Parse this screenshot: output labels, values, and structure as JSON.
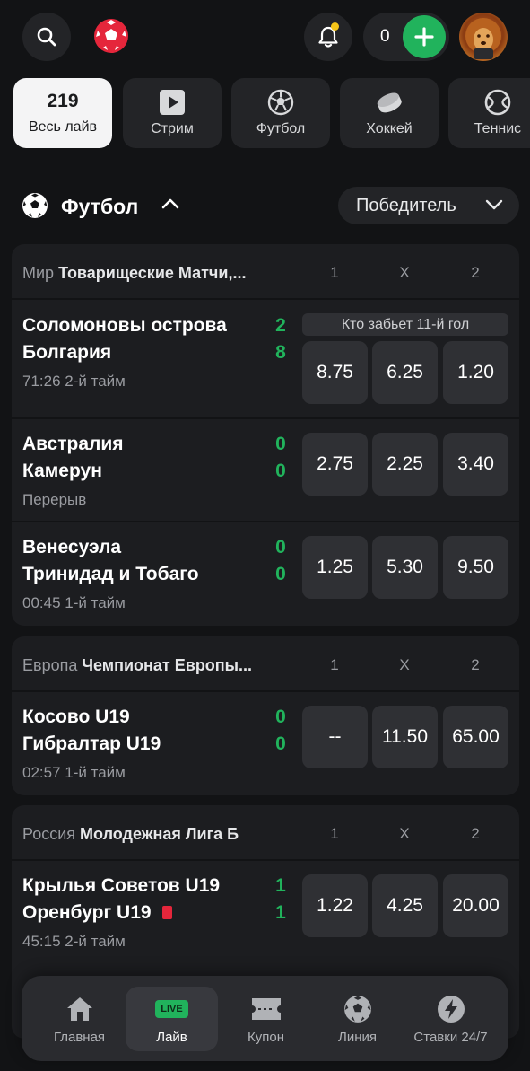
{
  "header": {
    "balance": "0",
    "icons": [
      "search-icon",
      "bell-icon",
      "plus-icon"
    ]
  },
  "categories": [
    {
      "count": "219",
      "label": "Весь лайв"
    },
    {
      "label": "Стрим",
      "icon": "play-icon"
    },
    {
      "label": "Футбол",
      "icon": "soccer-ball-icon"
    },
    {
      "label": "Хоккей",
      "icon": "hockey-puck-icon"
    },
    {
      "label": "Теннис",
      "icon": "tennis-ball-icon"
    }
  ],
  "sport": {
    "title": "Футбол",
    "market": "Победитель"
  },
  "columns": {
    "c1": "1",
    "cx": "X",
    "c2": "2"
  },
  "leagues": [
    {
      "region": "Мир",
      "name": "Товарищеские Матчи,...",
      "matches": [
        {
          "team1": "Соломоновы острова",
          "team2": "Болгария",
          "score1": "2",
          "score2": "8",
          "status": "71:26 2-й тайм",
          "market": "Кто забьет 11-й гол",
          "odd1": "8.75",
          "oddx": "6.25",
          "odd2": "1.20"
        },
        {
          "team1": "Австралия",
          "team2": "Камерун",
          "score1": "0",
          "score2": "0",
          "status": "Перерыв",
          "odd1": "2.75",
          "oddx": "2.25",
          "odd2": "3.40"
        },
        {
          "team1": "Венесуэла",
          "team2": "Тринидад и Тобаго",
          "score1": "0",
          "score2": "0",
          "status": "00:45 1-й тайм",
          "odd1": "1.25",
          "oddx": "5.30",
          "odd2": "9.50"
        }
      ]
    },
    {
      "region": "Европа",
      "name": "Чемпионат Европы...",
      "matches": [
        {
          "team1": "Косово U19",
          "team2": "Гибралтар U19",
          "score1": "0",
          "score2": "0",
          "status": "02:57 1-й тайм",
          "odd1": "--",
          "oddx": "11.50",
          "odd2": "65.00"
        }
      ]
    },
    {
      "region": "Россия",
      "name": "Молодежная Лига Б",
      "matches": [
        {
          "team1": "Крылья Советов U19",
          "team2": "Оренбург U19",
          "score1": "1",
          "score2": "1",
          "status": "45:15 2-й тайм",
          "odd1": "1.22",
          "oddx": "4.25",
          "odd2": "20.00"
        }
      ]
    }
  ],
  "nav": {
    "items": [
      {
        "label": "Главная",
        "icon": "home-icon"
      },
      {
        "label": "Лайв",
        "icon": "live-icon",
        "badge": "LIVE"
      },
      {
        "label": "Купон",
        "icon": "coupon-icon"
      },
      {
        "label": "Линия",
        "icon": "soccer-ball-icon"
      },
      {
        "label": "Ставки 24/7",
        "icon": "lightning-icon"
      }
    ]
  }
}
